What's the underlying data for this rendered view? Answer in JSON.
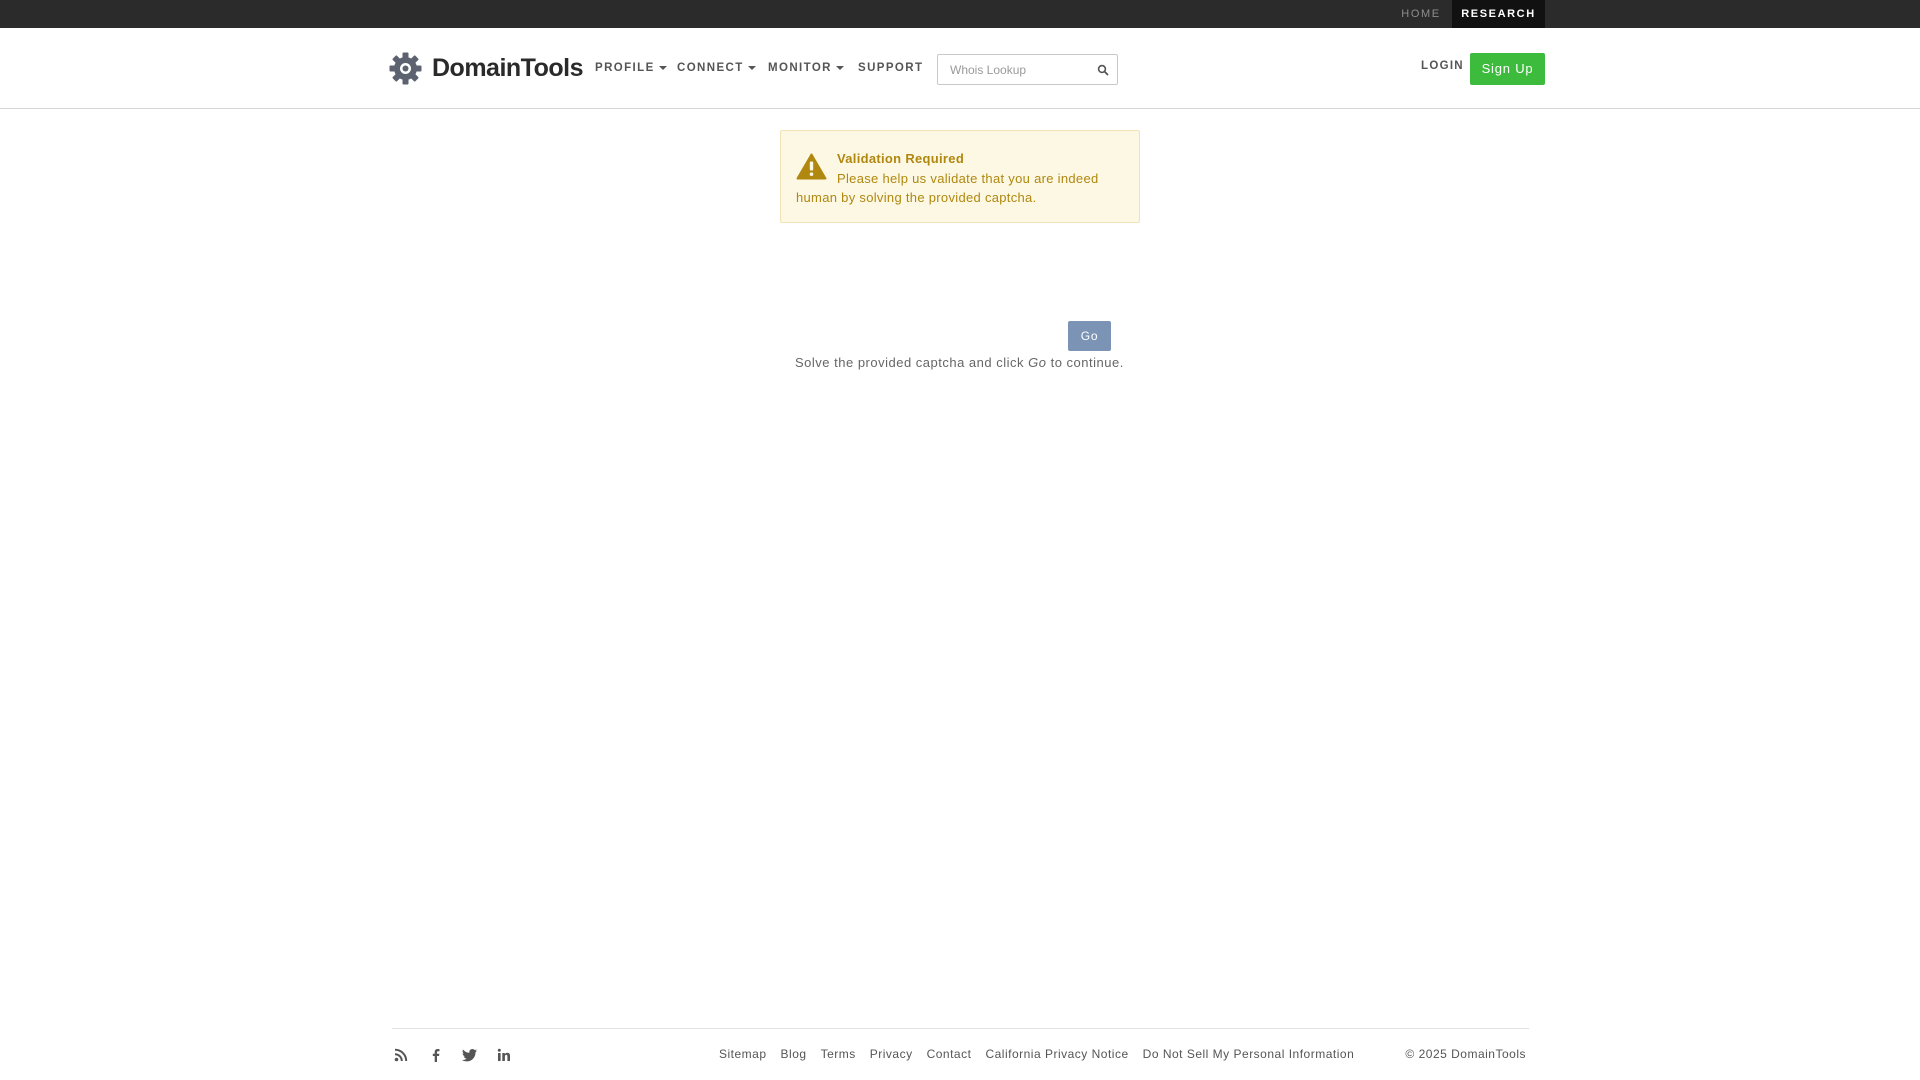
{
  "topbar": {
    "home_label": "HOME",
    "research_label": "RESEARCH"
  },
  "header": {
    "logo_text": "DomainTools",
    "nav": {
      "profile": "PROFILE",
      "connect": "CONNECT",
      "monitor": "MONITOR",
      "support": "SUPPORT"
    },
    "search": {
      "placeholder": "Whois Lookup",
      "value": ""
    },
    "login_label": "LOGIN",
    "signup_label": "Sign Up"
  },
  "alert": {
    "title": "Validation Required",
    "text": "Please help us validate that you are indeed human by solving the provided captcha."
  },
  "captcha": {
    "go_label": "Go",
    "note_before": "Solve the provided captcha and click ",
    "note_em": "Go",
    "note_after": " to continue."
  },
  "footer": {
    "social_icons": [
      "rss-icon",
      "facebook-icon",
      "twitter-icon",
      "linkedin-icon"
    ],
    "links": [
      "Sitemap",
      "Blog",
      "Terms",
      "Privacy",
      "Contact",
      "California Privacy Notice",
      "Do Not Sell My Personal Information"
    ],
    "copyright": "© 2025 DomainTools"
  },
  "colors": {
    "topbar_bg": "#2b2b2b",
    "signup_green": "#3dbb3d",
    "alert_bg": "#fcf8e3",
    "alert_text": "#b0870f",
    "go_button": "#7b94b6"
  }
}
